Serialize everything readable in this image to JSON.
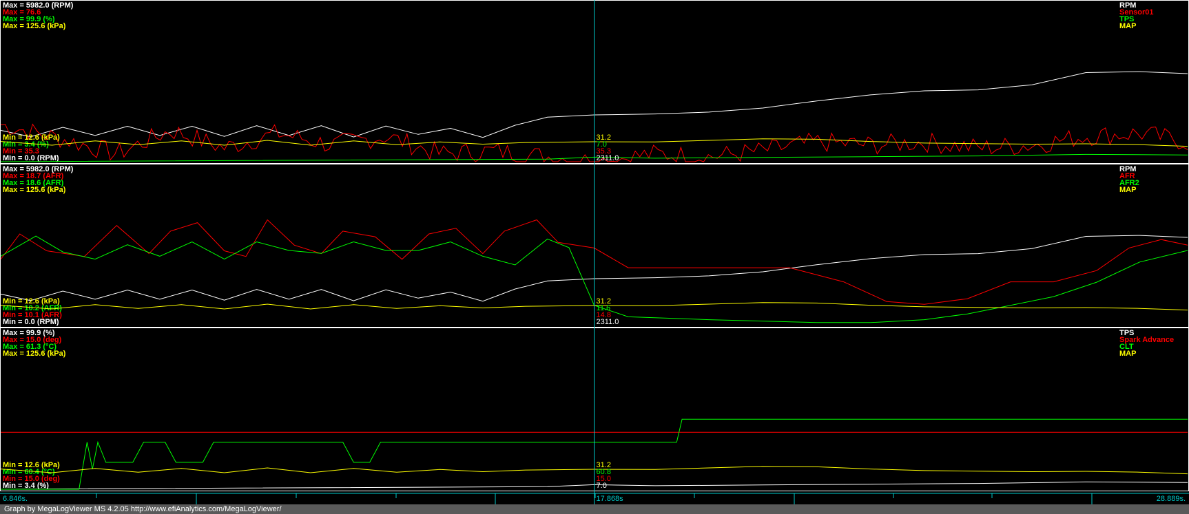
{
  "footer": "Graph by MegaLogViewer MS 4.2.05 http://www.efiAnalytics.com/MegaLogViewer/",
  "chart_data": {
    "type": "line",
    "time_axis": {
      "start_label": "6.846s.",
      "cursor_label": "17.868s",
      "end_label": "28.889s.",
      "range": [
        6.846,
        28.889
      ],
      "cursor": 17.868,
      "color": "#00cccc"
    },
    "panels": [
      {
        "name": "panel-1",
        "series": [
          {
            "name": "RPM",
            "color": "#ffffff",
            "max_label": "Max = 5982.0 (RPM)",
            "min_label": "Min = 0.0 (RPM)",
            "cursor_value": "2311.0",
            "range": [
              0,
              5982
            ],
            "style": "smooth",
            "t": [
              6.846,
              7.4,
              8.0,
              8.6,
              9.2,
              9.8,
              10.4,
              11.0,
              11.6,
              12.2,
              12.8,
              13.4,
              14.0,
              14.6,
              15.2,
              15.8,
              16.4,
              17.0,
              17.868,
              19.0,
              20.0,
              21.0,
              22.0,
              23.0,
              24.0,
              25.0,
              26.0,
              27.0,
              28.0,
              28.889
            ],
            "v": [
              1550,
              1230,
              1700,
              1300,
              1750,
              1300,
              1750,
              1250,
              1780,
              1300,
              1780,
              1220,
              1760,
              1350,
              1650,
              1200,
              1800,
              2200,
              2311,
              2360,
              2450,
              2650,
              3000,
              3300,
              3500,
              3550,
              3800,
              4400,
              4450,
              4350
            ]
          },
          {
            "name": "Sensor01",
            "color": "#ff0000",
            "max_label": "Max = 76.6",
            "min_label": "Min = 35.3",
            "cursor_value": "35.3",
            "range": [
              35.3,
              76.6
            ],
            "style": "noisy",
            "t": [
              6.846,
              8.0,
              9.0,
              10.0,
              11.0,
              12.0,
              13.0,
              14.0,
              15.0,
              16.0,
              17.0,
              17.868,
              19.0,
              20.0,
              21.0,
              22.0,
              23.0,
              24.0,
              25.0,
              26.0,
              27.0,
              28.0,
              28.889
            ],
            "v": [
              48,
              43,
              38,
              46,
              40,
              45,
              41,
              44,
              38,
              39,
              37,
              35.3,
              38,
              37,
              39,
              42,
              41,
              42,
              40,
              41,
              44,
              45,
              42
            ]
          },
          {
            "name": "TPS",
            "color": "#00ff00",
            "max_label": "Max = 99.9 (%)",
            "min_label": "Min = 3.4 (%)",
            "cursor_value": "7.0",
            "range": [
              3.4,
              99.9
            ],
            "style": "steps",
            "t": [
              6.846,
              17.0,
              17.868,
              19.0,
              21.0,
              23.0,
              25.0,
              27.0,
              28.889
            ],
            "v": [
              3.4,
              5.5,
              7.0,
              6.2,
              6.8,
              7.4,
              8.0,
              9.2,
              8.8
            ]
          },
          {
            "name": "MAP",
            "color": "#ffff00",
            "max_label": "Max = 125.6 (kPa)",
            "min_label": "Min = 12.6 (kPa)",
            "cursor_value": "31.2",
            "range": [
              12.6,
              125.6
            ],
            "style": "smooth",
            "t": [
              6.846,
              7.8,
              8.6,
              9.4,
              10.2,
              11.0,
              11.8,
              12.6,
              13.4,
              14.2,
              15.0,
              15.8,
              16.6,
              17.868,
              19.0,
              20.0,
              21.0,
              22.0,
              23.0,
              24.0,
              25.0,
              26.0,
              27.0,
              28.0,
              28.889
            ],
            "v": [
              31.5,
              28,
              32,
              28.5,
              32,
              28,
              32.5,
              28,
              32,
              28.5,
              31,
              29,
              30.5,
              31.2,
              31,
              32.5,
              34,
              33.5,
              31.5,
              30,
              29.5,
              29,
              29.3,
              28.5,
              27
            ]
          }
        ]
      },
      {
        "name": "panel-2",
        "series": [
          {
            "name": "RPM",
            "color": "#ffffff",
            "max_label": "Max = 5982.0 (RPM)",
            "min_label": "Min = 0.0 (RPM)",
            "cursor_value": "2311.0",
            "range": [
              0,
              5982
            ],
            "style": "smooth",
            "t": [
              6.846,
              7.4,
              8.0,
              8.6,
              9.2,
              9.8,
              10.4,
              11.0,
              11.6,
              12.2,
              12.8,
              13.4,
              14.0,
              14.6,
              15.2,
              15.8,
              16.4,
              17.0,
              17.868,
              19.0,
              20.0,
              21.0,
              22.0,
              23.0,
              24.0,
              25.0,
              26.0,
              27.0,
              28.0,
              28.889
            ],
            "v": [
              1550,
              1230,
              1700,
              1300,
              1750,
              1300,
              1750,
              1250,
              1780,
              1300,
              1780,
              1220,
              1760,
              1350,
              1650,
              1200,
              1800,
              2200,
              2311,
              2360,
              2450,
              2650,
              3000,
              3300,
              3500,
              3550,
              3800,
              4400,
              4450,
              4350
            ]
          },
          {
            "name": "AFR",
            "color": "#ff0000",
            "max_label": "Max = 18.7 (AFR)",
            "min_label": "Min = 10.1 (AFR)",
            "cursor_value": "14.8",
            "range": [
              10.1,
              18.7
            ],
            "style": "steps",
            "t": [
              6.846,
              7.2,
              7.7,
              8.4,
              9.0,
              9.6,
              10.0,
              10.5,
              11.0,
              11.4,
              11.8,
              12.3,
              12.8,
              13.2,
              13.8,
              14.3,
              14.8,
              15.3,
              15.8,
              16.2,
              16.8,
              17.2,
              17.868,
              18.5,
              19.5,
              20.5,
              21.5,
              22.5,
              23.3,
              24.0,
              24.8,
              25.6,
              26.4,
              27.2,
              27.8,
              28.4,
              28.889
            ],
            "v": [
              14.8,
              16.6,
              15.4,
              15.0,
              17.2,
              15.2,
              16.8,
              17.4,
              15.4,
              15.0,
              17.6,
              15.8,
              15.2,
              16.8,
              16.4,
              14.8,
              16.6,
              17.0,
              15.2,
              16.8,
              17.6,
              16.0,
              15.6,
              14.2,
              14.2,
              14.2,
              14.2,
              13.2,
              11.8,
              11.6,
              12.0,
              13.2,
              13.2,
              14.0,
              15.6,
              16.2,
              15.8
            ]
          },
          {
            "name": "AFR2",
            "color": "#00ff00",
            "max_label": "Max = 18.6 (AFR)",
            "min_label": "Min = 10.2 (AFR)",
            "cursor_value": "11.6",
            "range": [
              10.2,
              18.6
            ],
            "style": "steps",
            "t": [
              6.846,
              7.5,
              8.0,
              8.6,
              9.2,
              9.8,
              10.4,
              11.0,
              11.6,
              12.2,
              12.8,
              13.4,
              14.0,
              14.6,
              15.2,
              15.8,
              16.4,
              17.0,
              17.4,
              17.868,
              18.5,
              20.0,
              22.0,
              23.0,
              24.0,
              24.8,
              25.6,
              26.4,
              27.2,
              28.0,
              28.889
            ],
            "v": [
              15.0,
              16.4,
              15.3,
              14.8,
              15.8,
              15.0,
              16.0,
              14.8,
              16.0,
              15.4,
              15.2,
              16.0,
              15.4,
              15.4,
              16.0,
              15.0,
              14.4,
              16.2,
              15.6,
              11.6,
              10.8,
              10.6,
              10.4,
              10.4,
              10.6,
              11.0,
              11.6,
              12.2,
              13.2,
              14.6,
              15.4
            ]
          },
          {
            "name": "MAP",
            "color": "#ffff00",
            "max_label": "Max = 125.6 (kPa)",
            "min_label": "Min = 12.6 (kPa)",
            "cursor_value": "31.2",
            "range": [
              12.6,
              125.6
            ],
            "style": "smooth",
            "t": [
              6.846,
              7.8,
              8.6,
              9.4,
              10.2,
              11.0,
              11.8,
              12.6,
              13.4,
              14.2,
              15.0,
              15.8,
              16.6,
              17.868,
              19.0,
              20.0,
              21.0,
              22.0,
              23.0,
              24.0,
              25.0,
              26.0,
              27.0,
              28.0,
              28.889
            ],
            "v": [
              31.5,
              28,
              32,
              28.5,
              32,
              28,
              32.5,
              28,
              32,
              28.5,
              31,
              29,
              30.5,
              31.2,
              31,
              32.5,
              34,
              33.5,
              31.5,
              30,
              29.5,
              29,
              29.3,
              28.5,
              27
            ]
          }
        ]
      },
      {
        "name": "panel-3",
        "series": [
          {
            "name": "TPS",
            "color": "#ffffff",
            "max_label": "Max = 99.9 (%)",
            "min_label": "Min = 3.4 (%)",
            "cursor_value": "7.0",
            "range": [
              3.4,
              99.9
            ],
            "style": "steps",
            "t": [
              6.846,
              17.0,
              17.868,
              19.0,
              21.0,
              23.0,
              25.0,
              27.0,
              28.889
            ],
            "v": [
              3.4,
              5.5,
              7.0,
              6.2,
              6.8,
              7.4,
              8.0,
              9.2,
              8.8
            ]
          },
          {
            "name": "Spark Advance",
            "color": "#ff0000",
            "max_label": "Max = 15.0 (deg)",
            "min_label": "Min = 15.0 (deg)",
            "cursor_value": "15.0",
            "range": [
              15.0,
              15.0
            ],
            "style": "flat",
            "t": [
              6.846,
              28.889
            ],
            "v": [
              15.0,
              15.0
            ]
          },
          {
            "name": "CLT",
            "color": "#00ff00",
            "max_label": "Max = 61.3 (°C)",
            "min_label": "Min = 60.4 (°C)",
            "cursor_value": "60.8",
            "range": [
              60.4,
              61.3
            ],
            "style": "steps",
            "t": [
              6.846,
              8.3,
              8.45,
              8.55,
              8.65,
              8.8,
              9.3,
              9.5,
              9.9,
              10.1,
              10.6,
              10.8,
              13.2,
              13.4,
              13.7,
              13.9,
              17.868,
              19.4,
              19.5,
              28.889
            ],
            "v": [
              60.4,
              60.4,
              60.75,
              60.55,
              60.75,
              60.6,
              60.6,
              60.75,
              60.75,
              60.6,
              60.6,
              60.75,
              60.75,
              60.6,
              60.6,
              60.75,
              60.75,
              60.75,
              60.92,
              60.92
            ]
          },
          {
            "name": "MAP",
            "color": "#ffff00",
            "max_label": "Max = 125.6 (kPa)",
            "min_label": "Min = 12.6 (kPa)",
            "cursor_value": "31.2",
            "range": [
              12.6,
              125.6
            ],
            "style": "smooth",
            "t": [
              6.846,
              7.8,
              8.6,
              9.4,
              10.2,
              11.0,
              11.8,
              12.6,
              13.4,
              14.2,
              15.0,
              15.8,
              16.6,
              17.868,
              19.0,
              20.0,
              21.0,
              22.0,
              23.0,
              24.0,
              25.0,
              26.0,
              27.0,
              28.0,
              28.889
            ],
            "v": [
              31.5,
              28,
              32,
              28.5,
              32,
              28,
              32.5,
              28,
              32,
              28.5,
              31,
              29,
              30.5,
              31.2,
              31,
              32.5,
              34,
              33.5,
              31.5,
              30,
              29.5,
              29,
              29.3,
              28.5,
              27
            ]
          }
        ]
      }
    ]
  }
}
